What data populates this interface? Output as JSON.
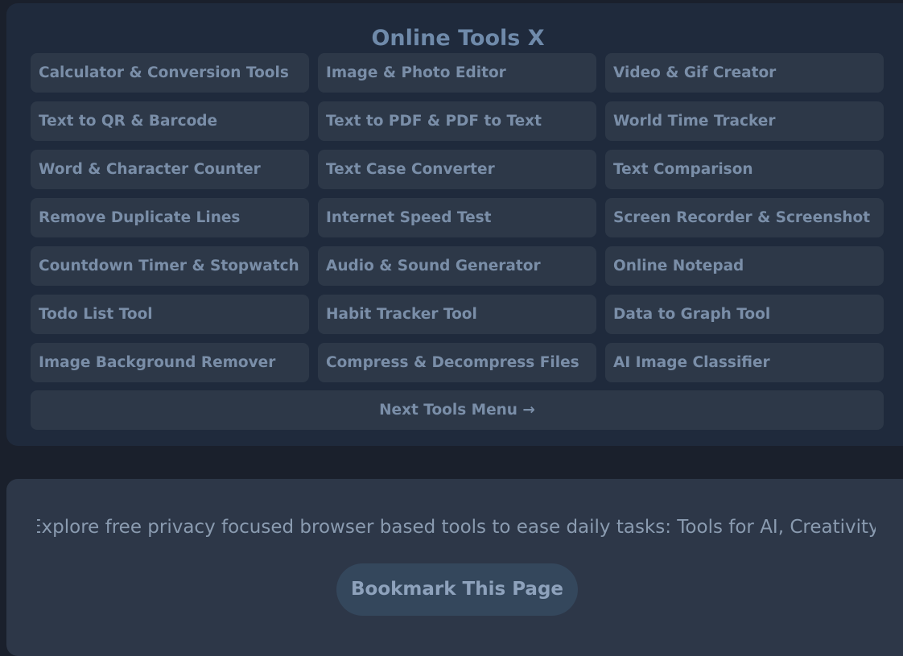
{
  "tools_panel": {
    "title": "Online Tools X",
    "tools": [
      {
        "label": "Calculator & Conversion Tools"
      },
      {
        "label": "Image & Photo Editor"
      },
      {
        "label": "Video & Gif Creator"
      },
      {
        "label": "Text to QR & Barcode"
      },
      {
        "label": "Text to PDF & PDF to Text"
      },
      {
        "label": "World Time Tracker"
      },
      {
        "label": "Word & Character Counter"
      },
      {
        "label": "Text Case Converter"
      },
      {
        "label": "Text Comparison"
      },
      {
        "label": "Remove Duplicate Lines"
      },
      {
        "label": "Internet Speed Test"
      },
      {
        "label": "Screen Recorder & Screenshot"
      },
      {
        "label": "Countdown Timer & Stopwatch"
      },
      {
        "label": "Audio & Sound Generator"
      },
      {
        "label": "Online Notepad"
      },
      {
        "label": "Todo List Tool"
      },
      {
        "label": "Habit Tracker Tool"
      },
      {
        "label": "Data to Graph Tool"
      },
      {
        "label": "Image Background Remover"
      },
      {
        "label": "Compress & Decompress Files"
      },
      {
        "label": "AI Image Classifier"
      }
    ],
    "next_label": "Next Tools Menu →"
  },
  "info_panel": {
    "marquee_text": "Explore free privacy focused browser based tools to ease daily tasks: Tools for AI, Creativity, Cor",
    "bookmark_label": "Bookmark This Page"
  }
}
